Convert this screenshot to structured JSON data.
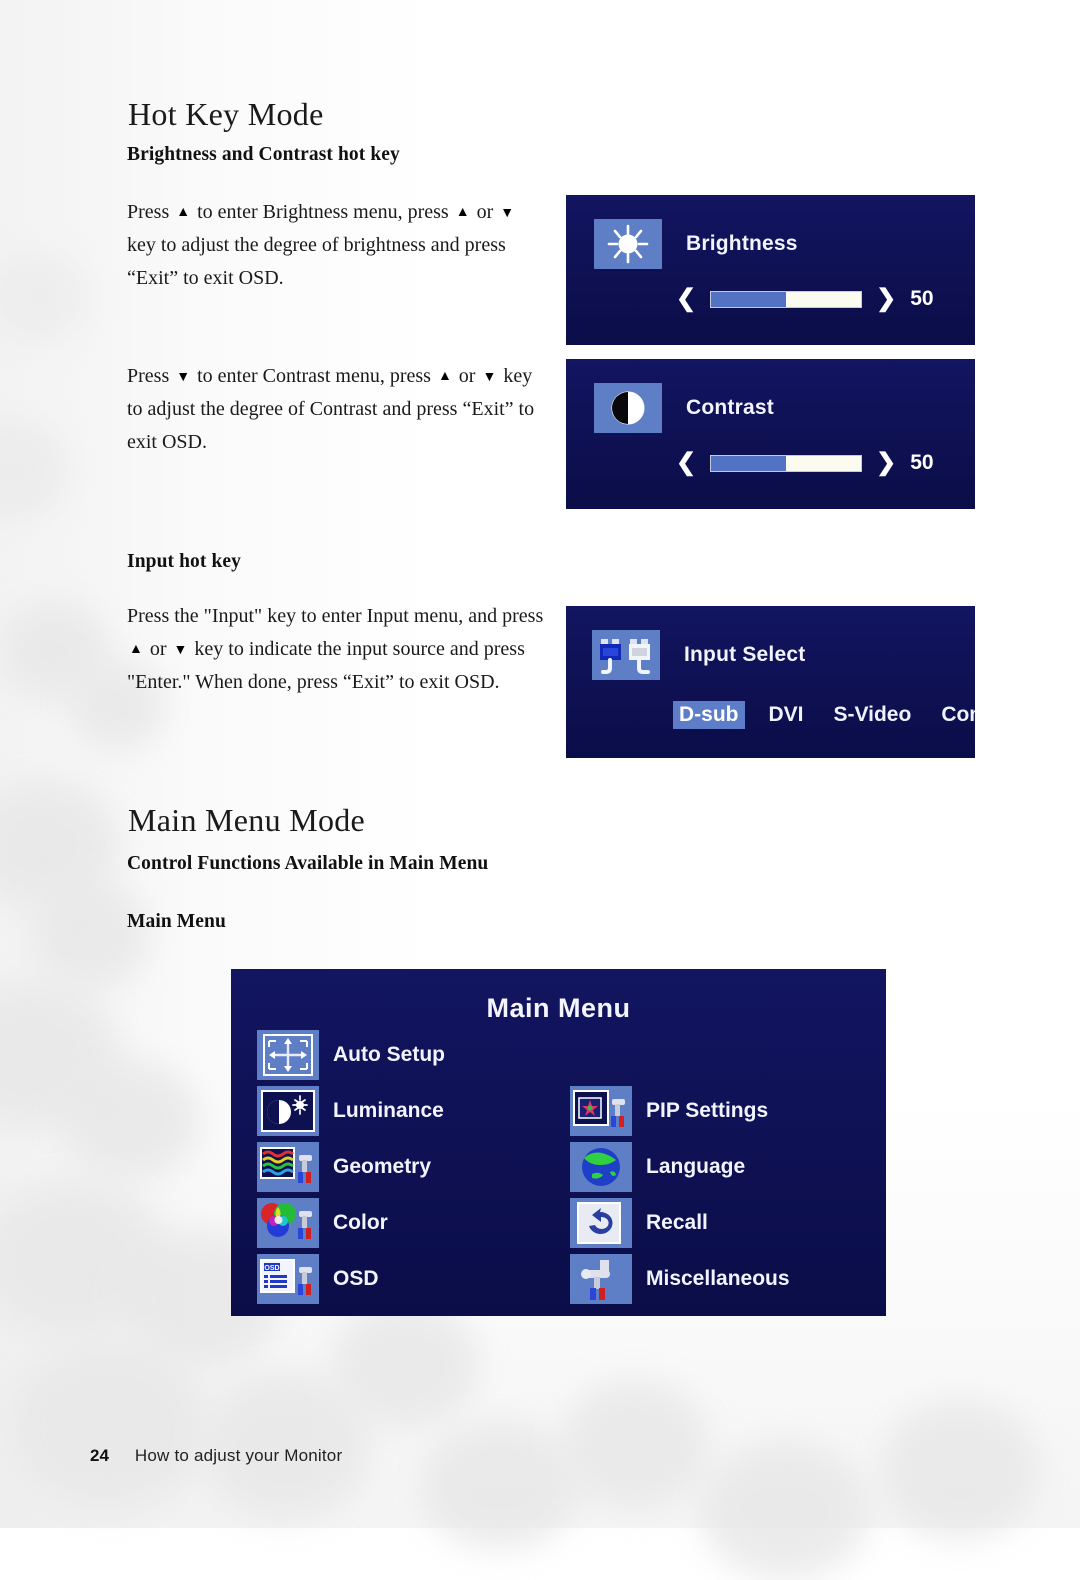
{
  "page": {
    "number": "24",
    "footer_text": "How to adjust your Monitor"
  },
  "sections": {
    "hotkey": {
      "title": "Hot Key Mode",
      "subheading_brightness_contrast": "Brightness and Contrast hot key",
      "brightness_paragraph": {
        "part1": "Press",
        "part2": "to enter Brightness menu, press",
        "part3": "or",
        "part4": "key to adjust the degree of brightness and press “Exit” to exit OSD."
      },
      "contrast_paragraph": {
        "part1": "Press",
        "part2": "to enter Contrast menu, press",
        "part3": "or",
        "part4": "key to adjust the degree of Contrast and press “Exit” to exit OSD."
      },
      "subheading_input": "Input hot key",
      "input_paragraph": {
        "part1": "Press the \"Input\" key to enter Input menu, and press",
        "part2": "or",
        "part3": "key to indicate the input source and press \"Enter.\" When done, press “Exit” to exit OSD."
      },
      "arrow_up_glyph": "▲",
      "arrow_down_glyph": "▼"
    },
    "mainmenu": {
      "title": "Main Menu Mode",
      "subheading_control": "Control Functions Available in Main Menu",
      "subheading_mainmenu": "Main Menu"
    }
  },
  "osd": {
    "brightness": {
      "label": "Brightness",
      "icon": "sun-icon",
      "value": "50",
      "fill_percent": 50,
      "left_chevron": "❮",
      "right_chevron": "❯"
    },
    "contrast": {
      "label": "Contrast",
      "icon": "contrast-circle-icon",
      "value": "50",
      "fill_percent": 50,
      "left_chevron": "❮",
      "right_chevron": "❯"
    },
    "input_select": {
      "label": "Input Select",
      "icon": "connectors-icon",
      "sources": [
        {
          "label": "D-sub",
          "selected": true
        },
        {
          "label": "DVI",
          "selected": false
        },
        {
          "label": "S-Video",
          "selected": false
        },
        {
          "label": "Comp.",
          "selected": false
        }
      ]
    },
    "main_menu": {
      "title": "Main Menu",
      "left_items": [
        {
          "label": "Auto Setup",
          "icon": "auto-setup-icon"
        },
        {
          "label": "Luminance",
          "icon": "luminance-icon"
        },
        {
          "label": "Geometry",
          "icon": "geometry-icon"
        },
        {
          "label": "Color",
          "icon": "color-icon"
        },
        {
          "label": "OSD",
          "icon": "osd-icon"
        }
      ],
      "right_items": [
        {
          "label": "PIP Settings",
          "icon": "pip-settings-icon"
        },
        {
          "label": "Language",
          "icon": "language-globe-icon"
        },
        {
          "label": "Recall",
          "icon": "recall-arrow-icon"
        },
        {
          "label": "Miscellaneous",
          "icon": "miscellaneous-tool-icon"
        }
      ]
    }
  },
  "colors": {
    "osd_background": "#0e1050",
    "osd_tile": "#5e7ec6",
    "osd_text": "#f2f4ff",
    "slider_fill": "#5272c4",
    "slider_track": "#fbfbf0",
    "selected_chip": "#5d7dc8"
  }
}
